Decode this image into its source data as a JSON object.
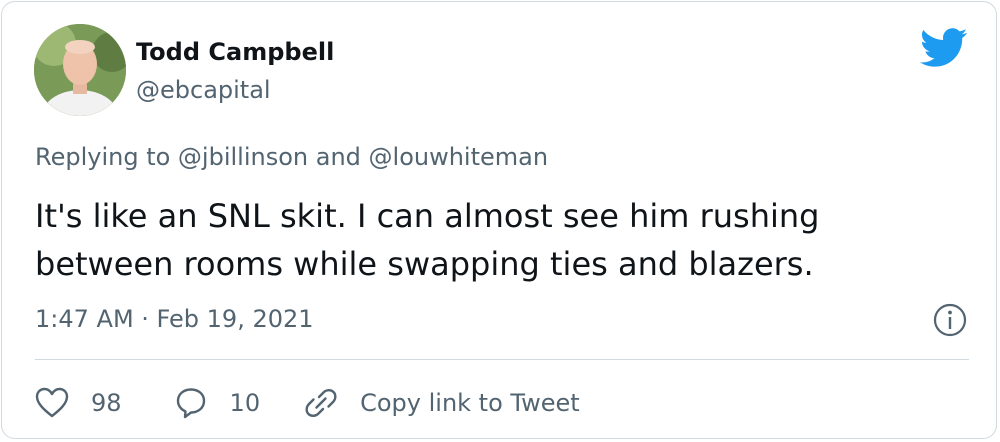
{
  "tweet": {
    "author_name": "Todd Campbell",
    "author_handle": "@ebcapital",
    "replying_to": "Replying to @jbillinson and @louwhiteman",
    "text": "It's like an SNL skit. I can almost see him rushing between rooms while swapping ties and blazers.",
    "timestamp": "1:47 AM · Feb 19, 2021"
  },
  "actions": {
    "like_count": "98",
    "reply_count": "10",
    "copy_link_label": "Copy link to Tweet"
  },
  "icons": {
    "brand": "twitter-bird-icon",
    "info": "info-icon",
    "like": "heart-icon",
    "reply": "speech-bubble-icon",
    "link": "link-icon"
  },
  "colors": {
    "brand": "#1d9bf0",
    "primary_text": "#0f1419",
    "secondary_text": "#536471",
    "border": "#cfd9de"
  }
}
